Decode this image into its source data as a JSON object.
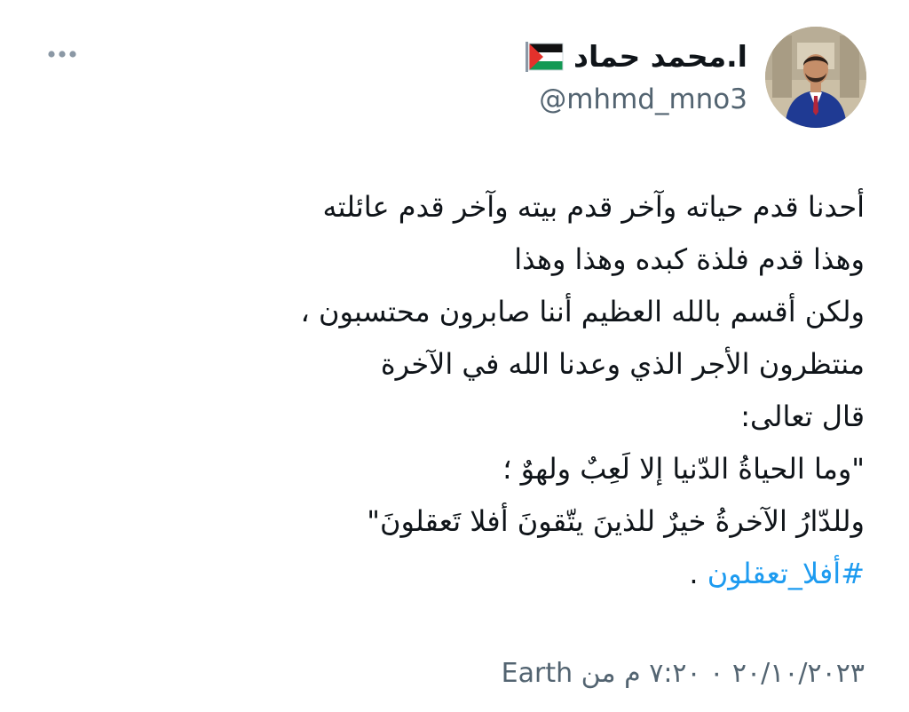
{
  "author": {
    "display_name": "ا.محمد حماد",
    "handle": "@mhmd_mno3",
    "flag_icon": "palestine-flag-icon",
    "avatar_icon": "profile-photo"
  },
  "tweet": {
    "lines": [
      "أحدنا قدم حياته وآخر قدم بيته وآخر قدم عائلته",
      "وهذا قدم فلذة كبده وهذا وهذا",
      "ولكن أقسم بالله العظيم أننا صابرون محتسبون ،",
      "منتظرون الأجر الذي وعدنا الله في الآخرة",
      "قال تعالى:",
      "\"وما الحياةُ الدّنيا إلا لَعِبٌ ولهوٌ ؛",
      "وللدّارُ الآخرةُ خيرٌ للذينَ يتّقونَ أفلا تَعقلونَ\""
    ],
    "hashtag": "#أفلا_تعقلون",
    "hashtag_tail": " ."
  },
  "meta": {
    "timestamp": "٢٠/١٠/٢٠٢٣ ٠ ٧:٢٠ م",
    "source_prefix": " من ",
    "source": "Earth"
  },
  "more_icon": "more-horizontal-icon",
  "colors": {
    "text": "#0f1419",
    "secondary": "#536471",
    "link": "#1d9bf0",
    "background": "#ffffff"
  }
}
